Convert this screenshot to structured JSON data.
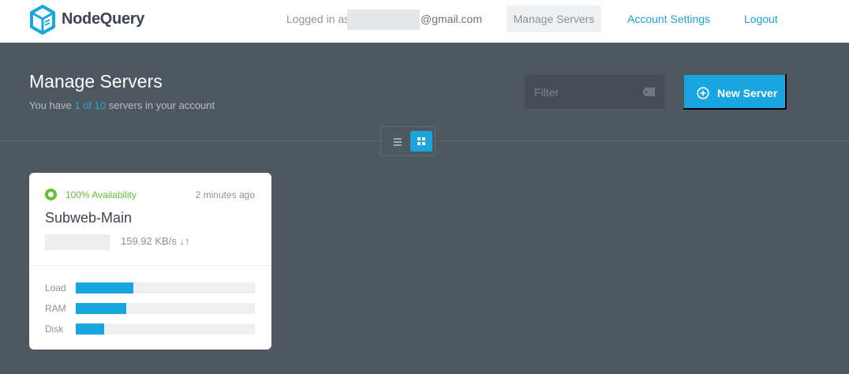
{
  "app": {
    "brand": "NodeQuery",
    "logo_icon": "cube-icon",
    "accent_color": "#19a6e0"
  },
  "nav": {
    "logged_in_prefix": "Logged in as",
    "email_domain": "@gmail.com",
    "items": [
      {
        "label": "Manage Servers"
      },
      {
        "label": "Account Settings"
      },
      {
        "label": "Logout"
      }
    ]
  },
  "header": {
    "title": "Manage Servers",
    "subtitle_prefix": "You have ",
    "subtitle_count": "1 of 10",
    "subtitle_suffix": " servers in your account",
    "filter_placeholder": "Filter",
    "filter_icon": "tag-icon",
    "new_server_label": "New Server",
    "new_server_icon": "plus-circle-icon"
  },
  "view_toggle": {
    "options": [
      "list-view-icon",
      "grid-view-icon"
    ],
    "selected": "grid-view-icon"
  },
  "servers": [
    {
      "availability": "100% Availability",
      "availability_color": "#63c132",
      "updated": "2 minutes ago",
      "name": "Subweb-Main",
      "traffic": "159.92 KB/s ↓↑",
      "metrics": [
        {
          "label": "Load",
          "value": 0.32
        },
        {
          "label": "RAM",
          "value": 0.28
        },
        {
          "label": "Disk",
          "value": 0.16
        }
      ]
    }
  ]
}
